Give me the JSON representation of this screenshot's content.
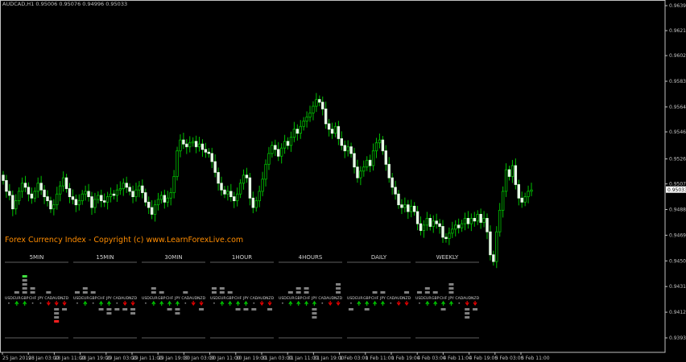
{
  "header": {
    "symbol": "AUDCAD,H1",
    "quote": "0.95006 0.95076 0.94996 0.95033"
  },
  "price_axis": {
    "labels": [
      "0.96395",
      "0.96210",
      "0.96025",
      "0.95835",
      "0.95645",
      "0.95460",
      "0.95260",
      "0.95075",
      "0.94885",
      "0.94695",
      "0.94505",
      "0.94315",
      "0.94125",
      "0.93935"
    ],
    "current_price": "0.95033"
  },
  "time_axis": {
    "labels": [
      "25 Jan 2019",
      "28 Jan 03:00",
      "28 Jan 11:00",
      "28 Jan 19:00",
      "29 Jan 03:00",
      "29 Jan 11:00",
      "29 Jan 19:00",
      "30 Jan 03:00",
      "30 Jan 11:00",
      "30 Jan 19:00",
      "31 Jan 03:00",
      "31 Jan 11:00",
      "31 Jan 19:00",
      "1 Feb 03:00",
      "1 Feb 11:00",
      "1 Feb 19:00",
      "4 Feb 03:00",
      "4 Feb 11:00",
      "4 Feb 19:00",
      "5 Feb 03:00",
      "5 Feb 11:00"
    ]
  },
  "indicator": {
    "title": "Forex Currency Index - Copyright (c) www.LearnForexLive.com",
    "timeframes": [
      "5MIN",
      "15MIN",
      "30MIN",
      "1HOUR",
      "4HOURS",
      "DAILY",
      "WEEKLY"
    ],
    "currencies": [
      "USD",
      "EUR",
      "GBP",
      "CHF",
      "JPY",
      "CAD",
      "AUD",
      "NZD"
    ],
    "colors": {
      "up": "#00c000",
      "down": "#e00000",
      "neutral": "#808080",
      "strong_up": "#40e040",
      "strong_down": "#ff2020"
    }
  },
  "chart_data": {
    "type": "candlestick",
    "symbol": "AUDCAD",
    "timeframe": "H1",
    "ylim": [
      0.93935,
      0.96395
    ],
    "close": [
      0.951,
      0.9502,
      0.9499,
      0.9489,
      0.9495,
      0.9502,
      0.9508,
      0.9505,
      0.95,
      0.9497,
      0.9502,
      0.9508,
      0.9503,
      0.9498,
      0.9495,
      0.9489,
      0.9492,
      0.95,
      0.9506,
      0.9512,
      0.9504,
      0.9498,
      0.9496,
      0.9492,
      0.9495,
      0.95,
      0.9502,
      0.9498,
      0.949,
      0.9496,
      0.9499,
      0.9495,
      0.9494,
      0.9498,
      0.95,
      0.9499,
      0.9503,
      0.9504,
      0.9508,
      0.9505,
      0.9502,
      0.9498,
      0.9503,
      0.9506,
      0.9501,
      0.9494,
      0.949,
      0.9485,
      0.9492,
      0.9496,
      0.9499,
      0.9494,
      0.9497,
      0.9501,
      0.9513,
      0.9532,
      0.954,
      0.9537,
      0.9535,
      0.9538,
      0.9539,
      0.9535,
      0.9537,
      0.9533,
      0.9531,
      0.953,
      0.9524,
      0.9516,
      0.9508,
      0.9503,
      0.95,
      0.9502,
      0.9498,
      0.9495,
      0.95,
      0.9508,
      0.9514,
      0.9512,
      0.9497,
      0.949,
      0.9495,
      0.9502,
      0.9511,
      0.9522,
      0.953,
      0.9536,
      0.9533,
      0.9528,
      0.9534,
      0.9539,
      0.9536,
      0.9542,
      0.9548,
      0.9545,
      0.955,
      0.9554,
      0.9557,
      0.956,
      0.9565,
      0.957,
      0.9568,
      0.9563,
      0.9552,
      0.9548,
      0.9545,
      0.955,
      0.9541,
      0.9536,
      0.9532,
      0.9535,
      0.953,
      0.952,
      0.9512,
      0.9517,
      0.952,
      0.9525,
      0.9521,
      0.9532,
      0.9538,
      0.954,
      0.9532,
      0.9522,
      0.9512,
      0.9505,
      0.95,
      0.9492,
      0.949,
      0.9492,
      0.9487,
      0.9491,
      0.9487,
      0.9478,
      0.9473,
      0.9477,
      0.9482,
      0.9476,
      0.948,
      0.9478,
      0.9476,
      0.9468,
      0.9467,
      0.9471,
      0.9474,
      0.9477,
      0.9475,
      0.9478,
      0.9482,
      0.9478,
      0.9482,
      0.948,
      0.9485,
      0.9479,
      0.9482,
      0.9472,
      0.9455,
      0.945,
      0.9472,
      0.9488,
      0.9502,
      0.9518,
      0.9513,
      0.9521,
      0.9507,
      0.9497,
      0.9494,
      0.9498,
      0.9502,
      0.9503
    ]
  }
}
